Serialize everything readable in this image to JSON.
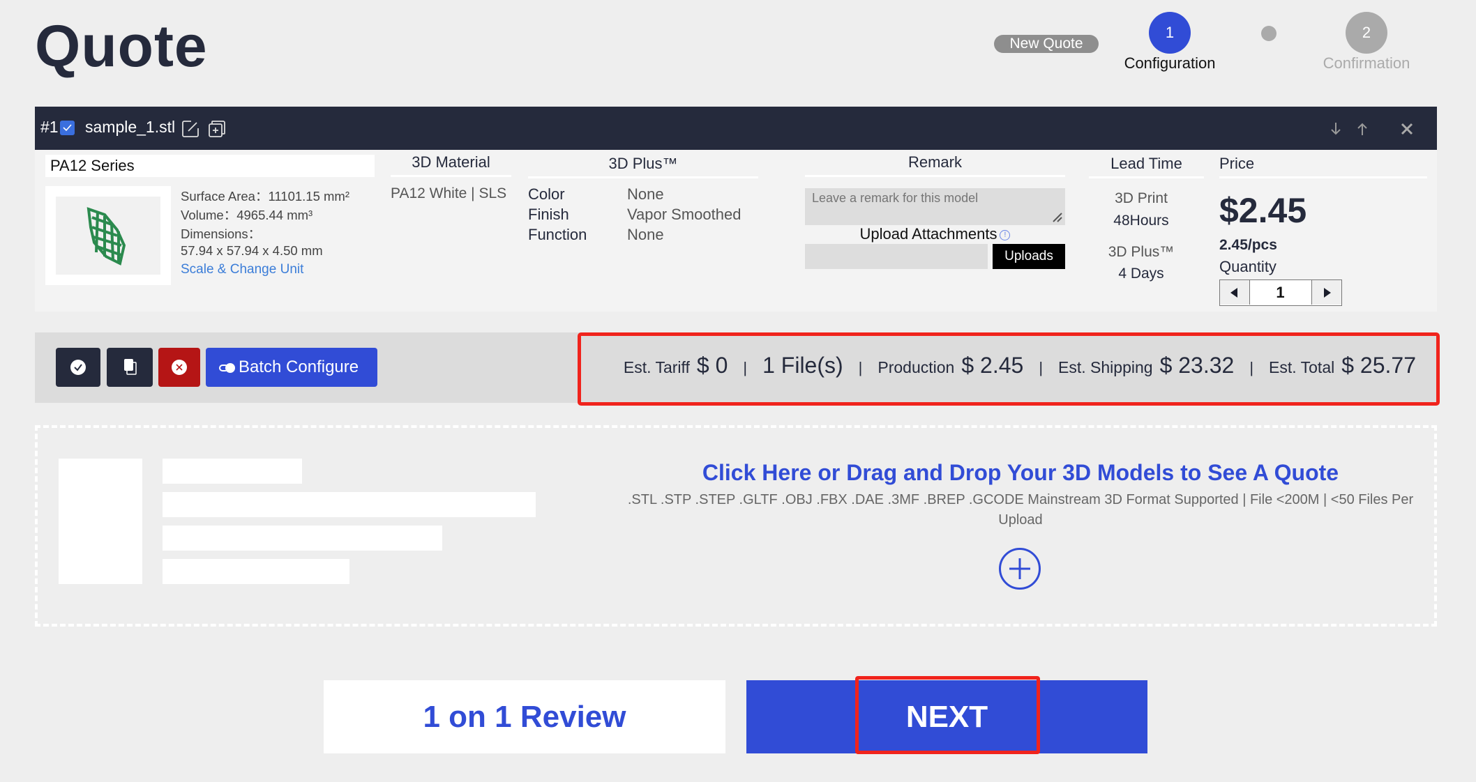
{
  "page": {
    "title": "Quote"
  },
  "steps": {
    "badge": "New Quote",
    "items": [
      {
        "number": "1",
        "label": "Configuration",
        "active": true
      },
      {
        "number": "2",
        "label": "Confirmation",
        "active": false
      }
    ]
  },
  "model": {
    "index": "#1",
    "checked": true,
    "file_name": "sample_1.stl",
    "series": "PA12 Series",
    "specs": {
      "surface_area": "Surface Area：11101.15 mm²",
      "volume": "Volume：4965.44 mm³",
      "dimensions_label": "Dimensions：",
      "dimensions": "57.94 x 57.94 x 4.50 mm"
    },
    "scale_link": "Scale & Change Unit",
    "columns": {
      "material": "3D Material",
      "plus": "3D Plus™",
      "remark": "Remark",
      "lead_time": "Lead Time",
      "price": "Price"
    },
    "material_value": "PA12 White | SLS",
    "plus_options": [
      {
        "key": "Color",
        "value": "None"
      },
      {
        "key": "Finish",
        "value": "Vapor Smoothed"
      },
      {
        "key": "Function",
        "value": "None"
      }
    ],
    "remark": {
      "value": "",
      "placeholder": "Leave a remark for this model"
    },
    "upload": {
      "title": "Upload Attachments",
      "button": "Uploads"
    },
    "lead_time": {
      "print_label": "3D Print",
      "print_value": "48Hours",
      "plus_label": "3D Plus™",
      "plus_value": "4 Days"
    },
    "price": {
      "total": "$2.45",
      "per_unit": "2.45/pcs",
      "quantity_label": "Quantity",
      "quantity": "1"
    }
  },
  "actions": {
    "batch_configure": "Batch Configure"
  },
  "summary": {
    "tariff_label": "Est. Tariff",
    "tariff_value": "$ 0",
    "files": "1 File(s)",
    "production_label": "Production",
    "production_value": "$ 2.45",
    "shipping_label": "Est. Shipping",
    "shipping_value": "$ 23.32",
    "total_label": "Est. Total",
    "total_value": "$ 25.77",
    "separator": "|"
  },
  "dropzone": {
    "title": "Click Here or Drag and Drop Your 3D Models to See A Quote",
    "subtitle": ".STL .STP .STEP .GLTF .OBJ .FBX .DAE .3MF .BREP .GCODE Mainstream 3D Format Supported | File <200M | <50 Files Per Upload"
  },
  "footer": {
    "review_button": "1 on 1 Review",
    "next_button": "NEXT"
  },
  "colors": {
    "accent": "#314cd6",
    "header": "#252a3c",
    "danger": "#b51515",
    "highlight": "#f0231c"
  }
}
